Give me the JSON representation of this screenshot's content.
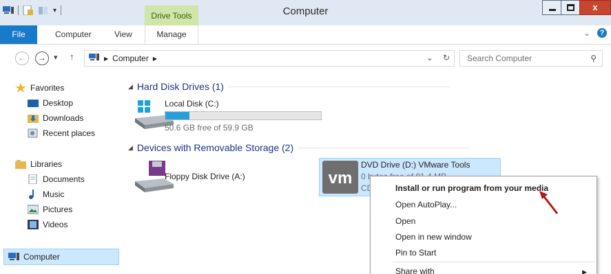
{
  "window": {
    "title": "Computer",
    "contextual_tab": "Drive Tools",
    "close_label": "x"
  },
  "ribbon": {
    "tabs": [
      "File",
      "Computer",
      "View",
      "Manage"
    ],
    "help_label": "?"
  },
  "addressbar": {
    "crumb": "Computer",
    "search_placeholder": "Search Computer"
  },
  "navpane": {
    "favorites": "Favorites",
    "desktop": "Desktop",
    "downloads": "Downloads",
    "recent": "Recent places",
    "libraries": "Libraries",
    "documents": "Documents",
    "music": "Music",
    "pictures": "Pictures",
    "videos": "Videos",
    "computer": "Computer"
  },
  "content": {
    "group_hdd": "Hard Disk Drives (1)",
    "group_removable": "Devices with Removable Storage (2)",
    "local_disk": {
      "name": "Local Disk (C:)",
      "free": "50.6 GB free of 59.9 GB",
      "used_fraction": 0.155
    },
    "floppy": {
      "name": "Floppy Disk Drive (A:)"
    },
    "dvd": {
      "name": "DVD Drive (D:) VMware Tools",
      "free": "0 bytes free of 81.4 MB",
      "fs": "CD"
    }
  },
  "context_menu": {
    "items": [
      "Install or run program from your media",
      "Open AutoPlay...",
      "Open",
      "Open in new window",
      "Pin to Start",
      "Share with"
    ]
  }
}
